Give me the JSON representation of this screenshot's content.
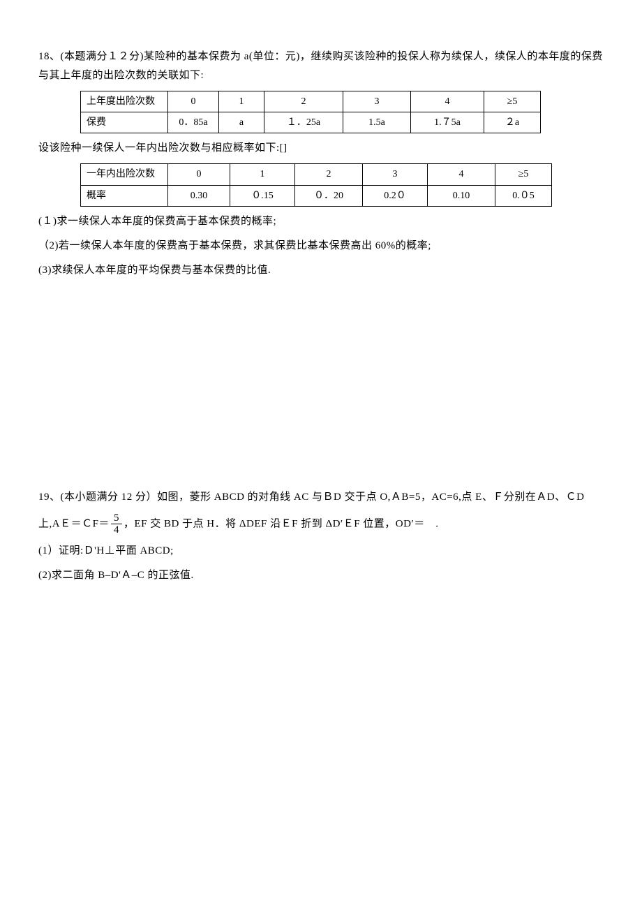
{
  "problem18": {
    "intro": "18、(本题满分１２分)某险种的基本保费为 a(单位：元)，继续购买该险种的投保人称为续保人，续保人的本年度的保费与其上年度的出险次数的关联如下:",
    "table1": {
      "header": "上年度出险次数",
      "cols": [
        "0",
        "1",
        "2",
        "3",
        "4",
        "≥5"
      ],
      "row_label": "保费",
      "row_vals": [
        "0．85a",
        "a",
        "１．25a",
        "1.5a",
        "1.７5a",
        "２a"
      ]
    },
    "line2": "设该险种一续保人一年内出险次数与相应概率如下:[]",
    "table2": {
      "header": "一年内出险次数",
      "cols": [
        "0",
        "1",
        "2",
        "3",
        "4",
        "≥5"
      ],
      "row_label": "概率",
      "row_vals": [
        "0.30",
        "０.15",
        "０．20",
        "0.2０",
        "0.10",
        "0.０5"
      ]
    },
    "q1": "(１)求一续保人本年度的保费高于基本保费的概率;",
    "q2": "（2)若一续保人本年度的保费高于基本保费，求其保费比基本保费高出 60%的概率;",
    "q3": "(3)求续保人本年度的平均保费与基本保费的比值."
  },
  "problem19": {
    "line1_a": "19、(本小题满分 12 分）如图，菱形 ABCD 的对角线 AC 与ＢD 交于点 O,ＡB=5，AC=6,点 E、Ｆ分别在ＡD、ＣD",
    "line1_b_pre": "上,AＥ＝ＣF＝",
    "frac_num": "5",
    "frac_den": "4",
    "line1_b_post": "，EF 交 BD 于点 H．将 ΔDEF 沿ＥF 折到 ΔD′ＥF 位置，OD′＝　.",
    "q1": "(1）证明:Ｄ'H⊥平面 ABCD;",
    "q2": "(2)求二面角 B–D'Ａ–C 的正弦值."
  }
}
